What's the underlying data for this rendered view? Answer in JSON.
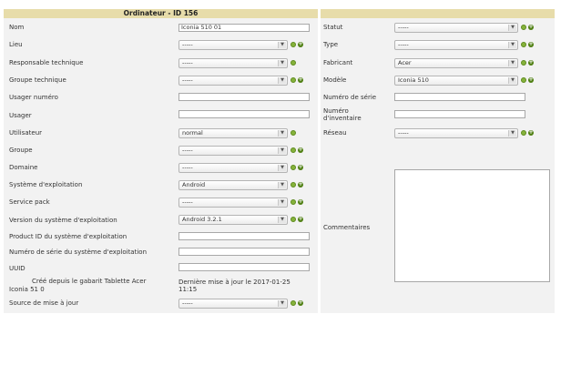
{
  "header": {
    "title": "Ordinateur - ID 156"
  },
  "icons": {
    "search": "magnifier-icon",
    "add": "plus-icon"
  },
  "left": {
    "nom": {
      "label": "Nom",
      "value": "Iconia 510 01"
    },
    "lieu": {
      "label": "Lieu",
      "value": "-----"
    },
    "responsable": {
      "label": "Responsable technique",
      "value": "-----"
    },
    "groupe_tech": {
      "label": "Groupe technique",
      "value": "-----"
    },
    "usager_num": {
      "label": "Usager numéro",
      "value": ""
    },
    "usager": {
      "label": "Usager",
      "value": ""
    },
    "utilisateur": {
      "label": "Utilisateur",
      "value": "normal"
    },
    "groupe": {
      "label": "Groupe",
      "value": "-----"
    },
    "domaine": {
      "label": "Domaine",
      "value": "-----"
    },
    "os": {
      "label": "Système d'exploitation",
      "value": "Android"
    },
    "sp": {
      "label": "Service pack",
      "value": "-----"
    },
    "os_version": {
      "label": "Version du système d'exploitation",
      "value": "Android 3.2.1"
    },
    "product_id": {
      "label": "Product ID du système d'exploitation",
      "value": ""
    },
    "os_serial": {
      "label": "Numéro de série du système d'exploitation",
      "value": ""
    },
    "uuid": {
      "label": "UUID",
      "value": ""
    },
    "created_from": {
      "line1": "Créé depuis le gabarit Tablette Acer",
      "line2": "Iconia 51 0"
    },
    "last_update": {
      "line1": "Dernière mise à jour le 2017-01-25",
      "line2": "11:15"
    },
    "source_maj": {
      "label": "Source de mise à jour",
      "value": "-----"
    }
  },
  "right": {
    "statut": {
      "label": "Statut",
      "value": "-----"
    },
    "type": {
      "label": "Type",
      "value": "-----"
    },
    "fabricant": {
      "label": "Fabricant",
      "value": "Acer"
    },
    "modele": {
      "label": "Modèle",
      "value": "Iconia 510"
    },
    "num_serie": {
      "label": "Numéro de série",
      "value": ""
    },
    "num_inventaire": {
      "line1": "Numéro",
      "line2": "d'inventaire",
      "value": ""
    },
    "reseau": {
      "label": "Réseau",
      "value": "-----"
    },
    "commentaires": {
      "label": "Commentaires",
      "value": ""
    }
  }
}
